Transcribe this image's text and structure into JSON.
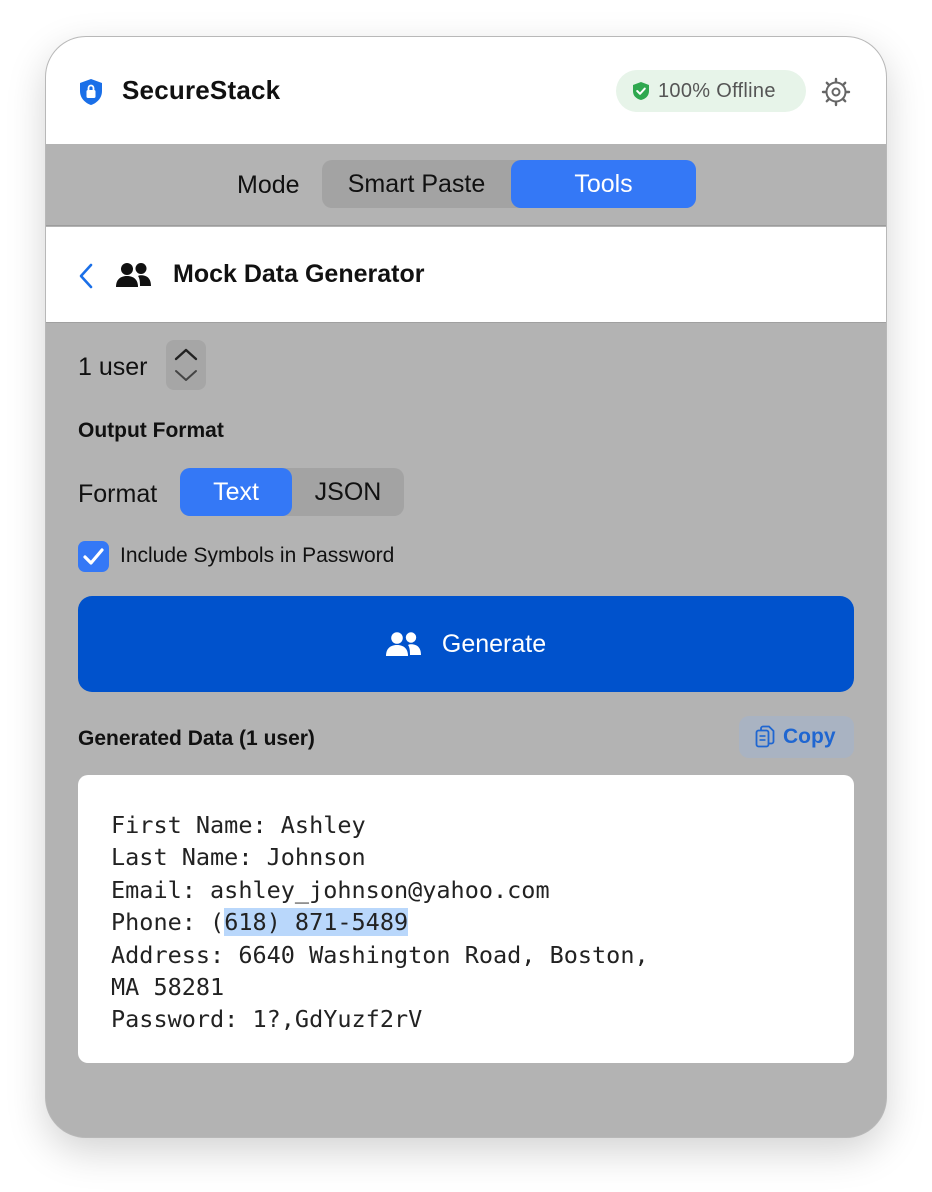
{
  "app": {
    "title": "SecureStack",
    "offline_badge": "100% Offline"
  },
  "mode": {
    "label": "Mode",
    "options": [
      "Smart Paste",
      "Tools"
    ],
    "selected": "Tools"
  },
  "header": {
    "title": "Mock Data Generator"
  },
  "options": {
    "count_label": "1 user",
    "section_title": "Output Format",
    "format_label": "Format",
    "formats": [
      "Text",
      "JSON"
    ],
    "selected_format": "Text",
    "include_symbols_label": "Include Symbols in Password",
    "include_symbols_checked": true
  },
  "generate": {
    "label": "Generate"
  },
  "result": {
    "title": "Generated Data (1 user)",
    "copy_label": "Copy",
    "lines": {
      "first_name": "First Name: Ashley",
      "last_name": "Last Name: Johnson",
      "email": "Email: ashley_johnson@yahoo.com",
      "phone_prefix": "Phone: (",
      "phone_selected": "618) 871-5489",
      "address_1": "Address: 6640 Washington Road, Boston,",
      "address_2": "MA 58281",
      "password": "Password: 1?,GdYuzf2rV"
    }
  },
  "colors": {
    "accent": "#3478f6",
    "primary_button": "#0052cc",
    "selection": "#b9d7fb",
    "panel_bg": "#b3b3b3"
  },
  "icons": [
    "shield-icon",
    "check-shield-icon",
    "gear-icon",
    "chevron-left-icon",
    "users-icon",
    "chevron-up-icon",
    "chevron-down-icon",
    "checkmark-icon",
    "copy-icon"
  ]
}
